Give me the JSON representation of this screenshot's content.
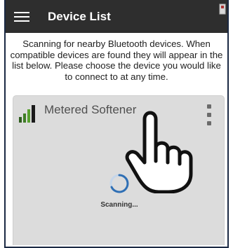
{
  "header": {
    "title": "Device List",
    "background_color": "#2e2e2e"
  },
  "description": "Scanning for nearby Bluetooth devices. When compatible devices are found they will appear in the list below. Please choose the device you would like to connect to at any time.",
  "devices": [
    {
      "name": "Metered Softener",
      "signal_icon": "signal-strength-icon",
      "menu_icon": "more-vertical-icon"
    }
  ],
  "scanning": {
    "label": "Scanning...",
    "spinner_color": "#2f6fb4"
  },
  "overlay": {
    "icon": "pointing-hand-icon"
  },
  "colors": {
    "signal_bars": [
      "#2f5e1e",
      "#3f7d26",
      "#57a02e",
      "#1a1a1a"
    ]
  }
}
